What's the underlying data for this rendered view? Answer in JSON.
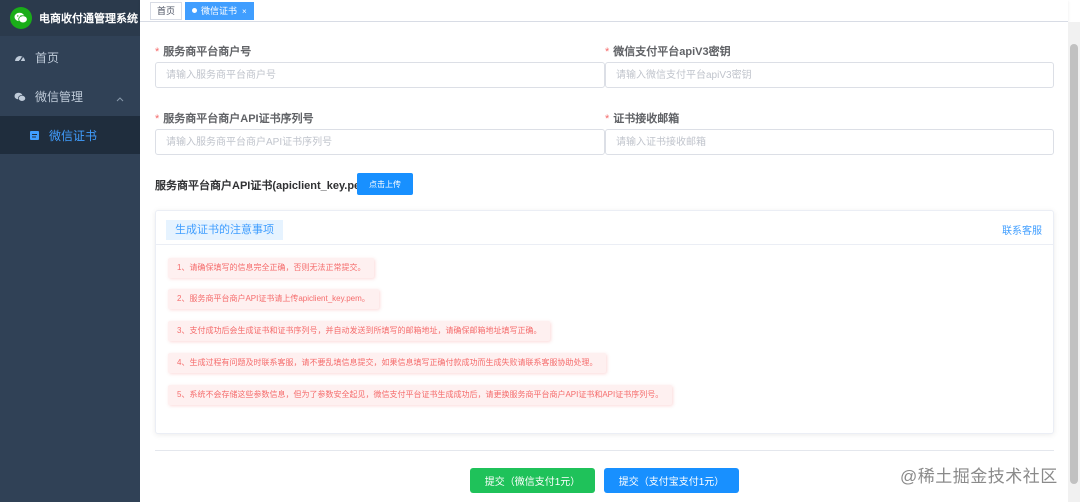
{
  "sidebar": {
    "brand_title": "电商收付通管理系统",
    "items": [
      {
        "label": "首页",
        "icon": "dashboard-icon"
      },
      {
        "label": "微信管理",
        "icon": "wechat-icon"
      }
    ],
    "sub_items": [
      {
        "label": "微信证书",
        "icon": "document-icon"
      }
    ]
  },
  "tabs": [
    {
      "label": "首页"
    },
    {
      "label": "微信证书",
      "close": "×"
    }
  ],
  "form": {
    "merchant_id": {
      "label": "服务商平台商户号",
      "placeholder": "请输入服务商平台商户号"
    },
    "apiv3_key": {
      "label": "微信支付平台apiV3密钥",
      "placeholder": "请输入微信支付平台apiV3密钥"
    },
    "cert_serial": {
      "label": "服务商平台商户API证书序列号",
      "placeholder": "请输入服务商平台商户API证书序列号"
    },
    "cert_email": {
      "label": "证书接收邮箱",
      "placeholder": "请输入证书接收邮箱"
    },
    "required_mark": "*",
    "upload_label": "服务商平台商户API证书(apiclient_key.pem)",
    "upload_button": "点击上传"
  },
  "notice": {
    "title": "生成证书的注意事项",
    "contact": "联系客服",
    "items": [
      "1、请确保填写的信息完全正确，否则无法正常提交。",
      "2、服务商平台商户API证书请上传apiclient_key.pem。",
      "3、支付成功后会生成证书和证书序列号，并自动发送到所填写的邮箱地址，请确保邮箱地址填写正确。",
      "4、生成过程有问题及时联系客服，请不要乱填信息提交，如果信息填写正确付款成功而生成失败请联系客服协助处理。",
      "5、系统不会存储这些参数信息，但为了参数安全起见，微信支付平台证书生成成功后，请更换服务商平台商户API证书和API证书序列号。"
    ]
  },
  "actions": {
    "submit_wechat": "提交（微信支付1元）",
    "submit_alipay": "提交（支付宝支付1元）"
  },
  "watermark": "@稀土掘金技术社区",
  "colors": {
    "sidebar_bg": "#304156",
    "accent": "#409eff",
    "tip_text": "#f56c6c",
    "tip_bg": "#fef0f0",
    "wechat_green": "#1fc25a"
  }
}
